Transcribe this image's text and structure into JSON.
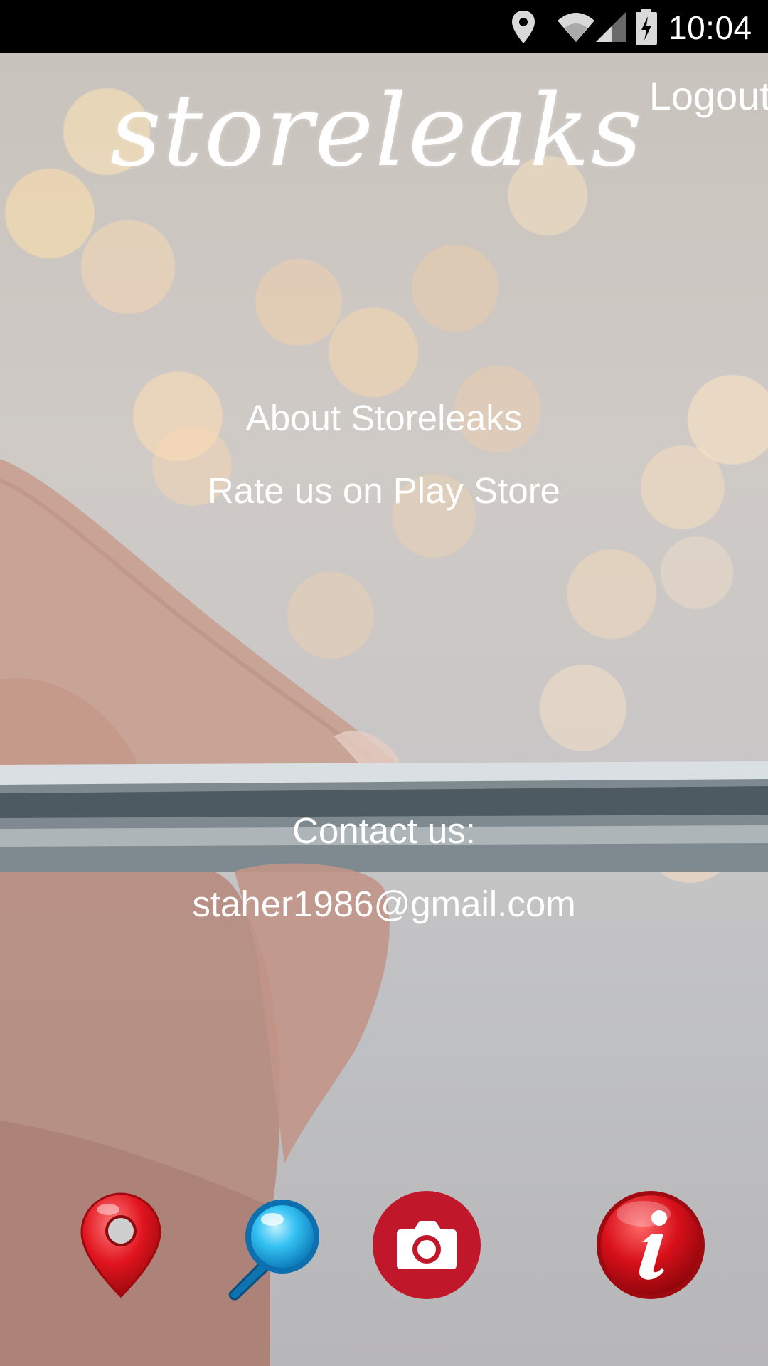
{
  "status_bar": {
    "time": "10:04",
    "icons": [
      "location-icon",
      "wifi-icon",
      "cell-signal-icon",
      "battery-charging-icon"
    ]
  },
  "header": {
    "logo_text": "storeleaks",
    "logout_label": "Logout"
  },
  "menu": {
    "about_label": "About Storeleaks",
    "rate_label": "Rate us on Play Store"
  },
  "contact": {
    "heading": "Contact us:",
    "email": "staher1986@gmail.com"
  },
  "bottom_nav": {
    "items": [
      {
        "icon": "map-pin-icon",
        "color": "#d7141c"
      },
      {
        "icon": "magnifier-icon",
        "color": "#29b6f0"
      },
      {
        "icon": "camera-icon",
        "color": "#c0182a"
      },
      {
        "icon": "info-icon",
        "color": "#d0101a"
      }
    ]
  },
  "colors": {
    "text": "#ffffff",
    "status_bar_bg": "#000000"
  }
}
